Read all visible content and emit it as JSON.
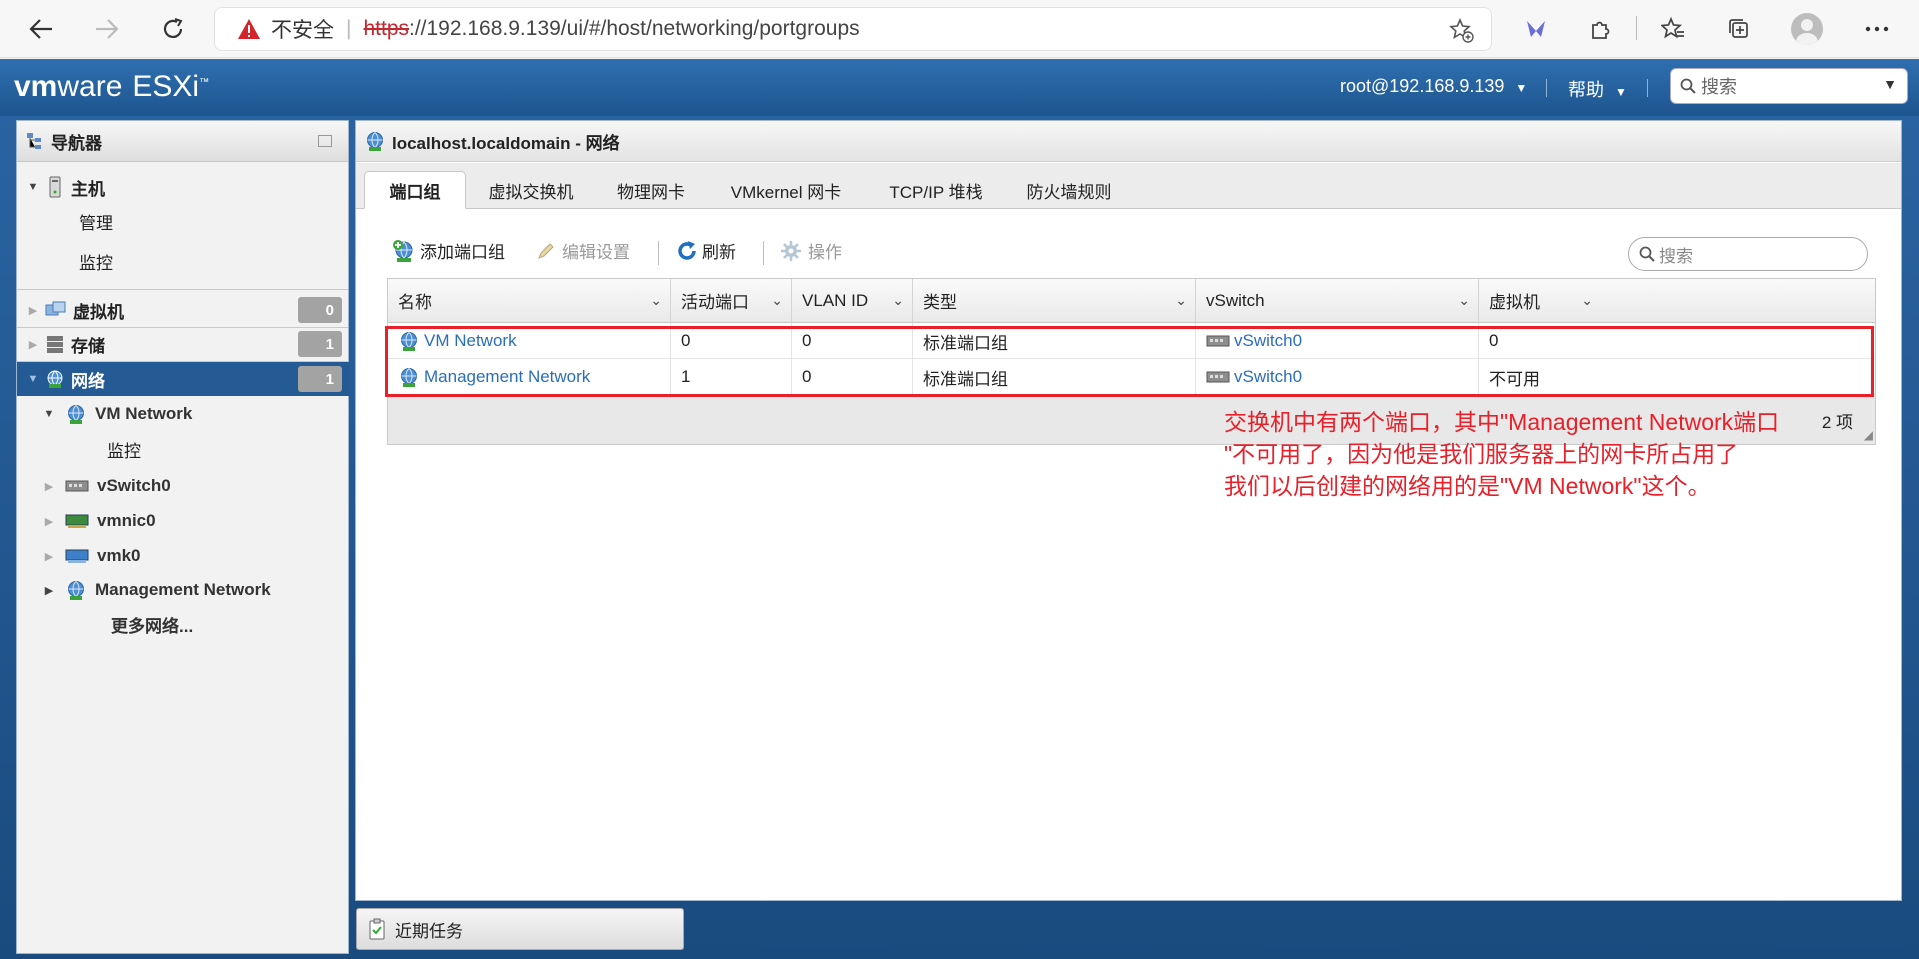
{
  "browser": {
    "security_label": "不安全",
    "url_scheme": "https",
    "url_rest": "://192.168.9.139/ui/#/host/networking/portgroups"
  },
  "header": {
    "logo_vm": "vm",
    "logo_ware": "ware",
    "logo_product": "ESXi",
    "user": "root@192.168.9.139",
    "help": "帮助",
    "search_placeholder": "搜索"
  },
  "navigator": {
    "title": "导航器",
    "host_label": "主机",
    "host_children": [
      "管理",
      "监控"
    ],
    "vm_label": "虚拟机",
    "vm_count": "0",
    "storage_label": "存储",
    "storage_count": "1",
    "network_label": "网络",
    "network_count": "1",
    "network_children": {
      "vm_network": "VM Network",
      "vm_network_monitor": "监控",
      "vswitch0": "vSwitch0",
      "vmnic0": "vmnic0",
      "vmk0": "vmk0",
      "management_network": "Management Network",
      "more": "更多网络..."
    }
  },
  "main": {
    "title": "localhost.localdomain - 网络",
    "tabs": [
      "端口组",
      "虚拟交换机",
      "物理网卡",
      "VMkernel 网卡",
      "TCP/IP 堆栈",
      "防火墙规则"
    ],
    "toolbar": {
      "add": "添加端口组",
      "edit": "编辑设置",
      "refresh": "刷新",
      "actions": "操作",
      "search_placeholder": "搜索"
    },
    "columns": [
      "名称",
      "活动端口",
      "VLAN ID",
      "类型",
      "vSwitch",
      "虚拟机"
    ],
    "rows": [
      {
        "name": "VM Network",
        "active_ports": "0",
        "vlan": "0",
        "type": "标准端口组",
        "vswitch": "vSwitch0",
        "vms": "0"
      },
      {
        "name": "Management Network",
        "active_ports": "1",
        "vlan": "0",
        "type": "标准端口组",
        "vswitch": "vSwitch0",
        "vms": "不可用"
      }
    ],
    "item_count": "2 项"
  },
  "annotation": {
    "line1": "交换机中有两个端口，其中\"Management Network端口",
    "line2": "\"不可用了，因为他是我们服务器上的网卡所占用了",
    "line3": "我们以后创建的网络用的是\"VM Network\"这个。"
  },
  "recent_tasks": "近期任务",
  "colors": {
    "accent_blue": "#255b94",
    "link": "#2a6ebb",
    "annotation_red": "#e8202a"
  }
}
